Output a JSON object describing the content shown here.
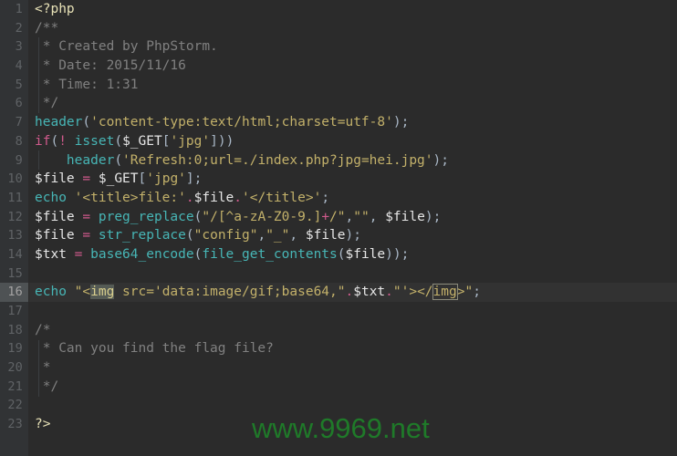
{
  "editor": {
    "language": "php",
    "theme_name": "darcula",
    "colors": {
      "background": "#2b2b2b",
      "gutter_background": "#313335",
      "current_line_background": "#323232",
      "current_line_number_background": "#4e5254",
      "line_number": "#606366",
      "default_text": "#a9b7c6",
      "comment": "#808080",
      "string": "#c3b16a",
      "keyword": "#d05a8c",
      "function": "#47b6b6",
      "variable": "#e6e6e6",
      "number": "#6897bb",
      "watermark": "#1f7a29"
    },
    "current_line": 16,
    "total_lines": 23
  },
  "watermark": {
    "text": "www.9969.net"
  },
  "line_numbers": [
    "1",
    "2",
    "3",
    "4",
    "5",
    "6",
    "7",
    "8",
    "9",
    "10",
    "11",
    "12",
    "13",
    "14",
    "15",
    "16",
    "17",
    "18",
    "19",
    "20",
    "21",
    "22",
    "23"
  ],
  "code_lines": [
    {
      "n": "1",
      "text": "<?php"
    },
    {
      "n": "2",
      "text": "/**"
    },
    {
      "n": "3",
      "text": " * Created by PhpStorm."
    },
    {
      "n": "4",
      "text": " * Date: 2015/11/16"
    },
    {
      "n": "5",
      "text": " * Time: 1:31"
    },
    {
      "n": "6",
      "text": " */"
    },
    {
      "n": "7",
      "text": "header('content-type:text/html;charset=utf-8');"
    },
    {
      "n": "8",
      "text": "if(! isset($_GET['jpg']))"
    },
    {
      "n": "9",
      "text": "    header('Refresh:0;url=./index.php?jpg=hei.jpg');"
    },
    {
      "n": "10",
      "text": "$file = $_GET['jpg'];"
    },
    {
      "n": "11",
      "text": "echo '<title>file:'.$file.'</title>';"
    },
    {
      "n": "12",
      "text": "$file = preg_replace(\"/[^a-zA-Z0-9.]+/\",\"\", $file);"
    },
    {
      "n": "13",
      "text": "$file = str_replace(\"config\",\"_\", $file);"
    },
    {
      "n": "14",
      "text": "$txt = base64_encode(file_get_contents($file));"
    },
    {
      "n": "15",
      "text": ""
    },
    {
      "n": "16",
      "text": "echo \"<img src='data:image/gif;base64,\".$txt.\"'></img>\";"
    },
    {
      "n": "17",
      "text": ""
    },
    {
      "n": "18",
      "text": "/*"
    },
    {
      "n": "19",
      "text": " * Can you find the flag file?"
    },
    {
      "n": "20",
      "text": " *"
    },
    {
      "n": "21",
      "text": " */"
    },
    {
      "n": "22",
      "text": ""
    },
    {
      "n": "23",
      "text": "?>"
    }
  ]
}
